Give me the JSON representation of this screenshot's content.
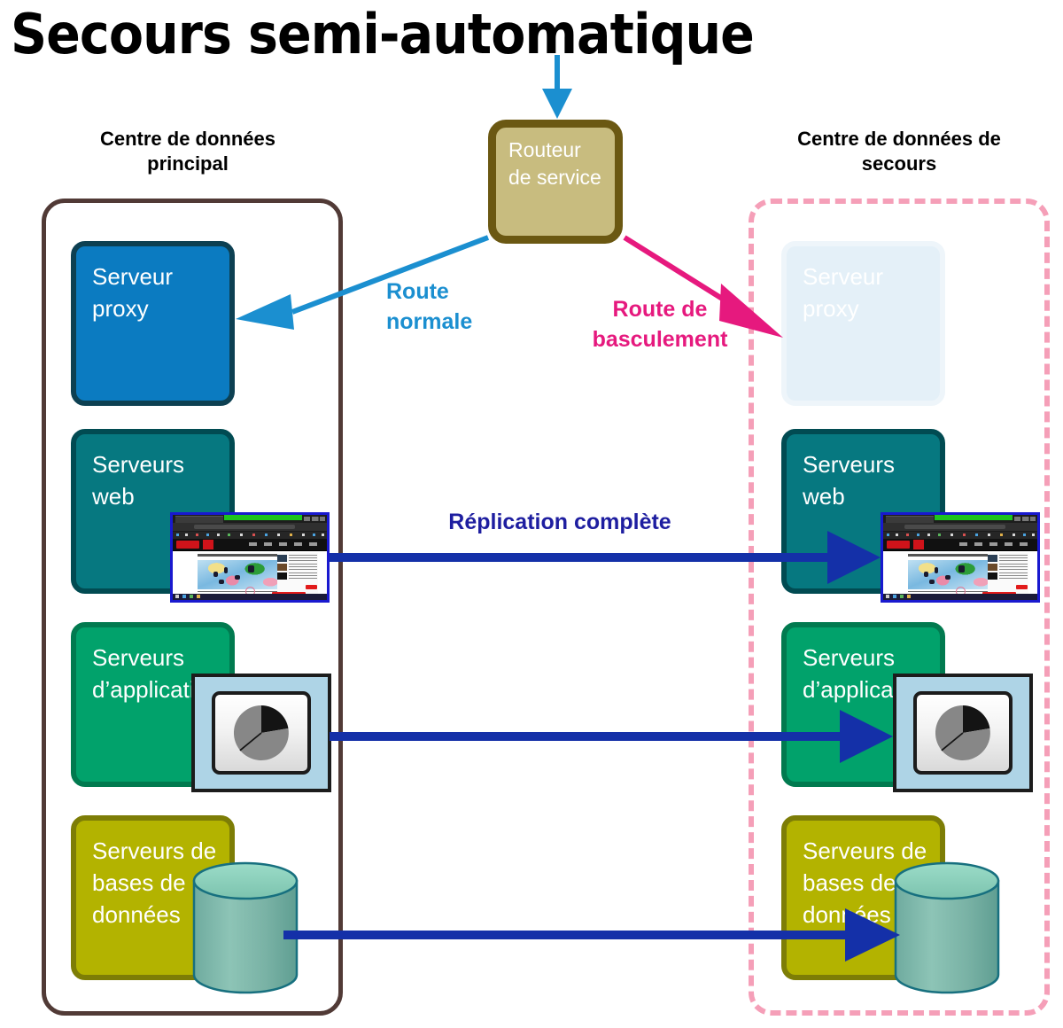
{
  "title": "Secours semi-automatique",
  "datacenters": {
    "primary": {
      "heading": "Centre de données\nprincipal",
      "border_color": "#513a36",
      "nodes": [
        {
          "id": "proxy",
          "label": "Serveur\nproxy",
          "fill": "#0b7bc1",
          "border": "#0d4052"
        },
        {
          "id": "web",
          "label": "Serveurs\nweb",
          "fill": "#067880",
          "border": "#014b52"
        },
        {
          "id": "app",
          "label": "Serveurs\nd’application",
          "fill": "#01a26b",
          "border": "#017a4f"
        },
        {
          "id": "db",
          "label": "Serveurs de\nbases de\ndonnées",
          "fill": "#b3b300",
          "border": "#7d7d06"
        }
      ]
    },
    "backup": {
      "heading": "Centre de données de\nsecours",
      "border_color": "#f59fb8",
      "nodes": [
        {
          "id": "proxy",
          "label": "Serveur\nproxy",
          "fill": "#e4f0f8",
          "border": "#eef5fa"
        },
        {
          "id": "web",
          "label": "Serveurs\nweb",
          "fill": "#067880",
          "border": "#014b52"
        },
        {
          "id": "app",
          "label": "Serveurs\nd’application",
          "fill": "#01a26b",
          "border": "#017a4f"
        },
        {
          "id": "db",
          "label": "Serveurs de\nbases de\ndonnées",
          "fill": "#b3b300",
          "border": "#7d7d06"
        }
      ]
    }
  },
  "router": {
    "label": "Routeur\nde service",
    "fill": "#c8bc7f",
    "border": "#6b5812"
  },
  "labels": {
    "route_normale": "Route\nnormale",
    "route_basculement": "Route de\nbasculement",
    "replication": "Réplication complète"
  },
  "colors": {
    "route_normale": "#1b8fd0",
    "route_basculement": "#e6197e",
    "replication_arrow": "#1430a8",
    "inbound_arrow": "#1b8fd0",
    "cylinder_body": "#79b5a8",
    "cylinder_top": "#8fd3c1",
    "cylinder_stroke": "#17707f",
    "monitor_frame": "#aed4e6",
    "pie_major": "#878787",
    "pie_minor": "#141414"
  },
  "icons": {
    "browser_thumbnail": "browser-window-screenshot",
    "monitor_pie": "monitor-pie-chart-icon",
    "database": "database-cylinder-icon"
  }
}
